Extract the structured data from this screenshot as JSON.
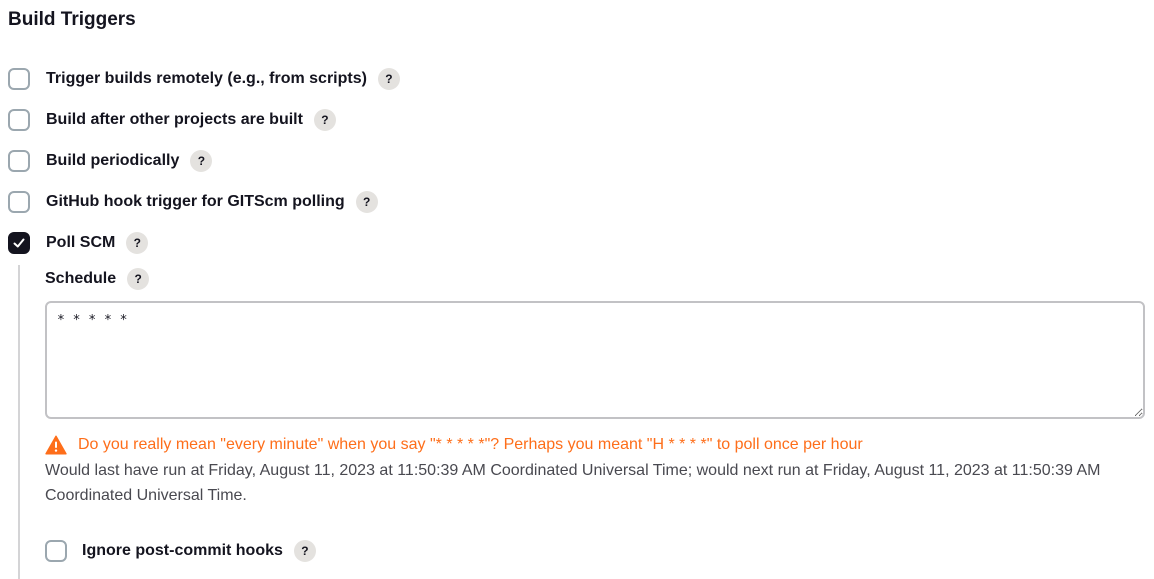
{
  "section": {
    "title": "Build Triggers"
  },
  "triggers": [
    {
      "label": "Trigger builds remotely (e.g., from scripts)",
      "checked": false,
      "help": "?"
    },
    {
      "label": "Build after other projects are built",
      "checked": false,
      "help": "?"
    },
    {
      "label": "Build periodically",
      "checked": false,
      "help": "?"
    },
    {
      "label": "GitHub hook trigger for GITScm polling",
      "checked": false,
      "help": "?"
    },
    {
      "label": "Poll SCM",
      "checked": true,
      "help": "?"
    }
  ],
  "poll_scm": {
    "schedule_label": "Schedule",
    "schedule_help": "?",
    "schedule_value": "* * * * *",
    "warning_icon": "warning-triangle-icon",
    "warning_text": "Do you really mean \"every minute\" when you say \"* * * * *\"? Perhaps you meant \"H * * * *\" to poll once per hour",
    "info_text": "Would last have run at Friday, August 11, 2023 at 11:50:39 AM Coordinated Universal Time; would next run at Friday, August 11, 2023 at 11:50:39 AM Coordinated Universal Time.",
    "ignore_hooks": {
      "label": "Ignore post-commit hooks",
      "checked": false,
      "help": "?"
    }
  },
  "colors": {
    "warning": "#fe6e1a",
    "checkbox_checked": "#14141f",
    "help_bg": "#e4e2df"
  }
}
